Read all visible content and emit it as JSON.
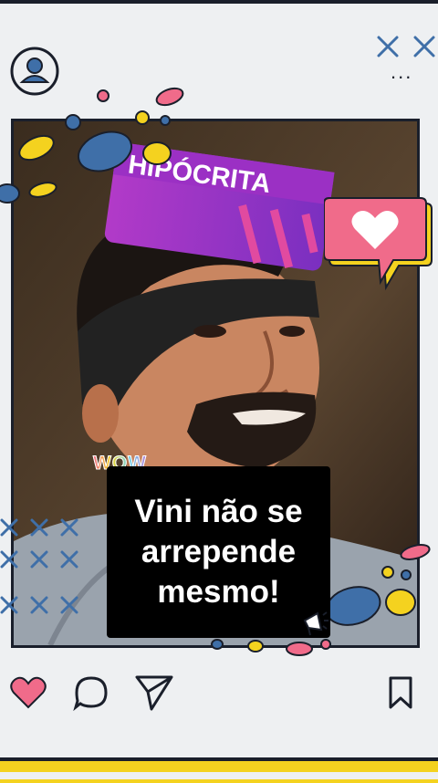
{
  "header": {
    "profile_icon": "user-circle-icon",
    "close_marks": "x-icons",
    "more_icon": "more-dots-icon",
    "more_glyph": "..."
  },
  "post": {
    "image_desc": "photo-of-man-with-headband",
    "sign_text": "HIPÓCRITA",
    "sticker_text": "WOW",
    "caption": "Vini não se arrepende mesmo!"
  },
  "actions": {
    "like_icon": "heart-icon",
    "comment_icon": "comment-icon",
    "share_icon": "send-icon",
    "save_icon": "bookmark-icon"
  },
  "colors": {
    "accent_yellow": "#f4d21f",
    "accent_pink": "#f06b8a",
    "accent_blue": "#3f6fa8",
    "frame_dark": "#1a1f2b",
    "background": "#eef0f2"
  }
}
